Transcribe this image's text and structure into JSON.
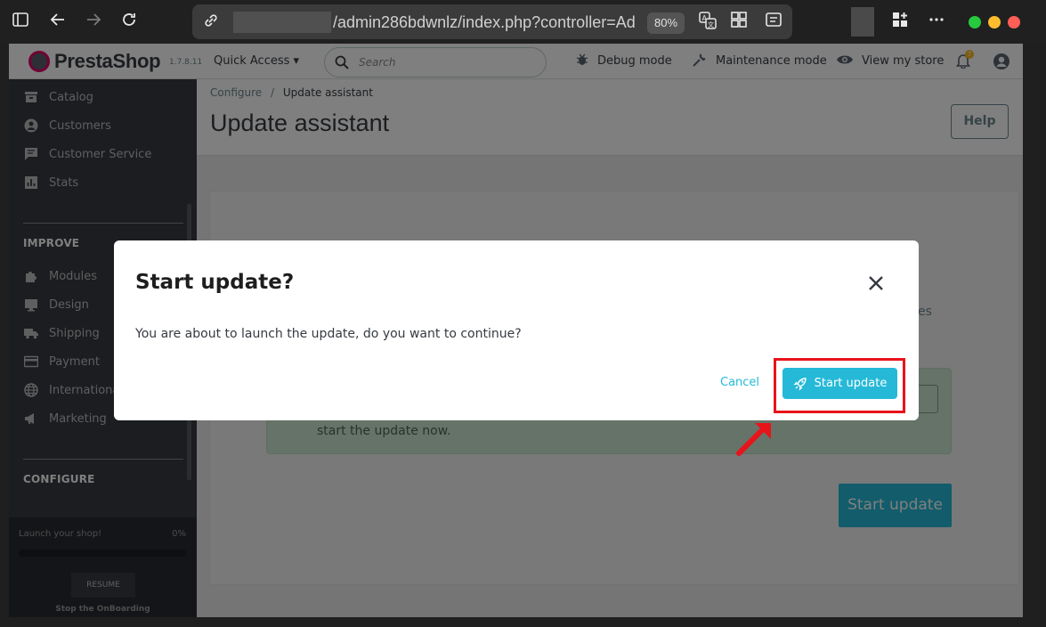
{
  "browser": {
    "url_text": "/admin286bdwnlz/index.php?controller=Adm",
    "zoom": "80%",
    "icons": [
      "sidebar-toggle-icon",
      "back-icon",
      "forward-icon",
      "reload-icon",
      "site-info-icon",
      "translate-icon",
      "apps-icon",
      "reader-icon",
      "extensions-icon",
      "more-icon"
    ]
  },
  "header": {
    "logo": "PrestaShop",
    "version": "1.7.8.11",
    "quick_access": "Quick Access",
    "search_placeholder": "Search",
    "debug_mode": "Debug mode",
    "maintenance_mode": "Maintenance mode",
    "view_store": "View my store",
    "notifications_count": "7"
  },
  "sidebar": {
    "items_top": [
      {
        "label": "Catalog",
        "icon": "catalog-icon"
      },
      {
        "label": "Customers",
        "icon": "customers-icon"
      },
      {
        "label": "Customer Service",
        "icon": "chat-icon"
      },
      {
        "label": "Stats",
        "icon": "stats-icon"
      }
    ],
    "section_improve": "IMPROVE",
    "items_improve": [
      {
        "label": "Modules",
        "icon": "puzzle-icon"
      },
      {
        "label": "Design",
        "icon": "monitor-icon"
      },
      {
        "label": "Shipping",
        "icon": "truck-icon"
      },
      {
        "label": "Payment",
        "icon": "card-icon"
      },
      {
        "label": "International",
        "icon": "globe-icon"
      },
      {
        "label": "Marketing",
        "icon": "megaphone-icon"
      }
    ],
    "section_configure": "CONFIGURE",
    "onboarding": {
      "label": "Launch your shop!",
      "progress": "0%",
      "resume": "RESUME",
      "stop": "Stop the OnBoarding"
    }
  },
  "content": {
    "breadcrumb_parent": "Configure",
    "breadcrumb_sep": "/",
    "breadcrumb_current": "Update assistant",
    "title": "Update assistant",
    "help": "Help",
    "behind_text_fragment": "es",
    "alert_text": "start the update now.",
    "start_update_big": "Start update"
  },
  "modal": {
    "title": "Start update?",
    "body": "You are about to launch the update, do you want to continue?",
    "cancel": "Cancel",
    "confirm": "Start update"
  },
  "colors": {
    "accent": "#25b9d7",
    "sidebar": "#363a41",
    "highlight": "#e8141b"
  }
}
